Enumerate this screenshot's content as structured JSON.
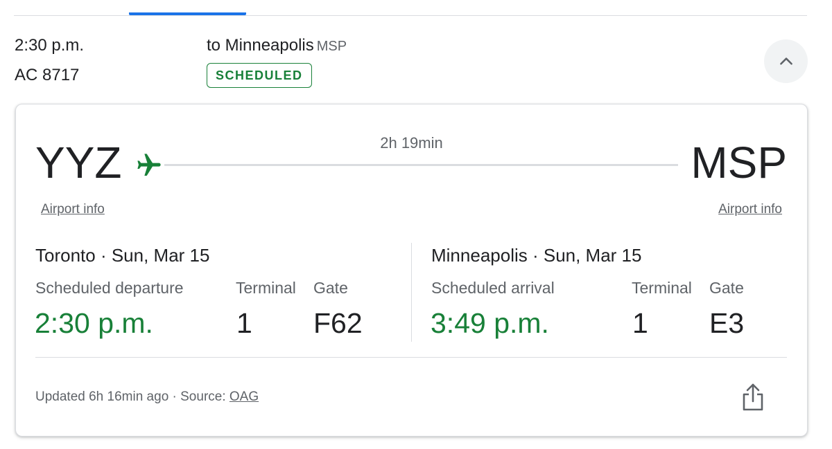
{
  "summary": {
    "departure_time": "2:30 p.m.",
    "flight_number": "AC 8717",
    "destination_prefix": "to Minneapolis",
    "destination_code": "MSP",
    "status": "SCHEDULED"
  },
  "route": {
    "origin_code": "YYZ",
    "destination_code": "MSP",
    "duration": "2h 19min",
    "origin_airport_link": "Airport info",
    "destination_airport_link": "Airport info"
  },
  "departure": {
    "city_date": "Toronto · Sun, Mar 15",
    "time_label": "Scheduled departure",
    "terminal_label": "Terminal",
    "gate_label": "Gate",
    "time": "2:30 p.m.",
    "terminal": "1",
    "gate": "F62"
  },
  "arrival": {
    "city_date": "Minneapolis · Sun, Mar 15",
    "time_label": "Scheduled arrival",
    "terminal_label": "Terminal",
    "gate_label": "Gate",
    "time": "3:49 p.m.",
    "terminal": "1",
    "gate": "E3"
  },
  "footer": {
    "updated": "Updated 6h 16min ago · Source: ",
    "source": "OAG"
  },
  "icons": {
    "collapse": "chevron-up-icon",
    "plane": "airplane-icon",
    "share": "share-icon"
  },
  "colors": {
    "accent_blue": "#1a73e8",
    "status_green": "#188038",
    "text_primary": "#202124",
    "text_secondary": "#5f6368"
  }
}
